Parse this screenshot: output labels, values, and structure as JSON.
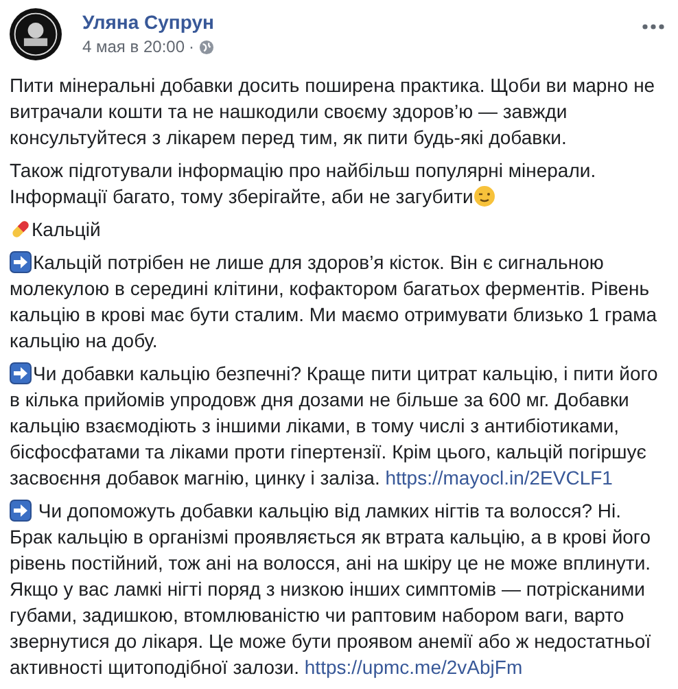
{
  "post": {
    "author": "Уляна Супрун",
    "time": "4 мая в 20:00",
    "separator": "·",
    "paragraphs": [
      {
        "kind": "plain",
        "text": "Пити мінеральні добавки досить поширена практика. Щоби ви марно не витрачали кошти та не нашкодили своєму здоров’ю — завжди консультуйтеся з лікарем перед тим, як пити будь-які добавки."
      },
      {
        "kind": "wink",
        "text": "Також підготували інформацію про найбільш популярні мінерали. Інформації багато, тому зберігайте, аби не загубити"
      },
      {
        "kind": "pill",
        "text": "Кальцій"
      },
      {
        "kind": "arrow",
        "text": "Кальцій потрібен не лише для здоров’я кісток. Він є сигнальною молекулою в середині клітини, кофактором багатьох ферментів. Рівень кальцію в крові має бути сталим. Ми маємо отримувати близько 1 грама кальцію на добу."
      },
      {
        "kind": "arrow",
        "text": "Чи добавки кальцію безпечні? Краще пити цитрат кальцію, і пити його в кілька прийомів упродовж дня дозами не більше за 600 мг. Добавки кальцію взаємодіють з іншими ліками, в тому числі з антибіотиками, бісфосфатами та ліками проти гіпертензії. Крім цього, кальцій погіршує засвоєння добавок магнію, цинку і заліза.",
        "link": "https://mayocl.in/2EVCLF1"
      },
      {
        "kind": "arrow",
        "text": " Чи допоможуть добавки кальцію від ламких нігтів та волосся? Ні. Брак кальцію в організмі проявляється як втрата кальцію, а в крові його рівень постійний, тож ані на волосся, ані на шкіру це не може вплинути. Якщо у вас ламкі нігті поряд з низкою інших симптомів — потрісканими губами, задишкою, втомлюваністю чи раптовим набором ваги, варто звернутися до лікаря. Це може бути проявом анемії або ж недостатньої активності щитоподібної залози.",
        "link": "https://upmc.me/2vAbjFm"
      }
    ]
  }
}
